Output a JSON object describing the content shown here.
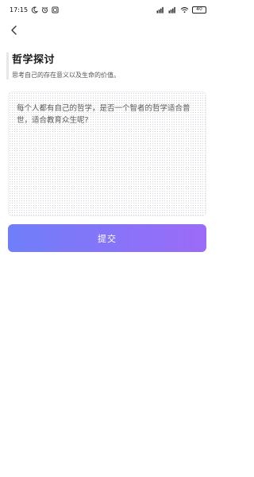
{
  "status_bar": {
    "time": "17:15",
    "battery": "40"
  },
  "header": {
    "back_icon": "chevron-left-icon"
  },
  "page": {
    "title": "哲学探讨",
    "subtitle": "思考自己的存在意义以及生命的价值。"
  },
  "question": {
    "text": "每个人都有自己的哲学，是否一个智者的哲学适合普世，适合教育众生呢?"
  },
  "actions": {
    "submit_label": "提交"
  },
  "colors": {
    "accent_start": "#6f7ef9",
    "accent_end": "#9c6bf7"
  }
}
